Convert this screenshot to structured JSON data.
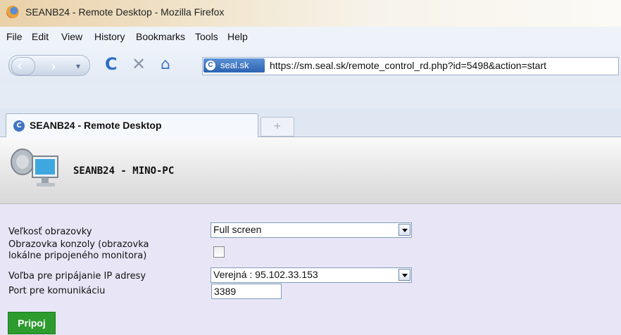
{
  "window": {
    "title": "SEANB24 - Remote Desktop - Mozilla Firefox"
  },
  "menu": {
    "items": [
      "File",
      "Edit",
      "View",
      "History",
      "Bookmarks",
      "Tools",
      "Help"
    ]
  },
  "nav": {
    "site_identity": "seal.sk",
    "url": "https://sm.seal.sk/remote_control_rd.php?id=5498&action=start"
  },
  "tabs": [
    {
      "label": "SEANB24 - Remote Desktop"
    }
  ],
  "new_tab_symbol": "+",
  "page": {
    "host_label": "SEANB24 - MINO-PC",
    "fields": {
      "screen_size": {
        "label": "Veľkosť obrazovky",
        "value": "Full screen"
      },
      "console": {
        "label_line1": "Obrazovka konzoly (obrazovka",
        "label_line2": "lokálne pripojeného monitora)",
        "checked": false
      },
      "ip_choice": {
        "label": "Voľba pre pripájanie IP adresy",
        "value": "Verejná : 95.102.33.153"
      },
      "port": {
        "label": "Port pre komunikáciu",
        "value": "3389"
      }
    },
    "connect_button": "Pripoj"
  },
  "icons": [
    "firefox-logo-icon",
    "back-icon",
    "forward-icon",
    "dropdown-icon",
    "reload-icon",
    "stop-icon",
    "home-icon",
    "site-identity-icon",
    "tab-favicon-icon",
    "computer-icon"
  ],
  "colors": {
    "connect_button": "#2d9b2e",
    "page_background": "#e8e6f6",
    "title_gradient_start": "#e9d1a8"
  }
}
